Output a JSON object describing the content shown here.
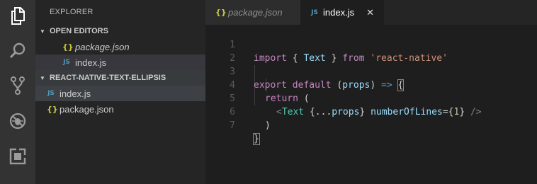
{
  "activity_bar": {
    "icons": [
      "files-icon",
      "search-icon",
      "source-control-icon",
      "debug-icon",
      "extensions-icon"
    ]
  },
  "sidebar": {
    "title": "EXPLORER",
    "open_editors": {
      "header": "OPEN EDITORS",
      "items": [
        {
          "icon": "{}",
          "label": "package.json"
        },
        {
          "icon": "JS",
          "label": "index.js"
        }
      ]
    },
    "project": {
      "header": "REACT-NATIVE-TEXT-ELLIPSIS",
      "items": [
        {
          "icon": "JS",
          "label": "index.js"
        },
        {
          "icon": "{}",
          "label": "package.json"
        }
      ]
    }
  },
  "tabs": [
    {
      "icon": "{}",
      "label": "package.json"
    },
    {
      "icon": "JS",
      "label": "index.js",
      "close": "✕"
    }
  ],
  "editor": {
    "line_numbers": [
      "1",
      "2",
      "3",
      "4",
      "5",
      "6",
      "7"
    ],
    "lines": {
      "l1": {
        "import": "import",
        "b1": " { ",
        "name": "Text",
        "b2": " } ",
        "from": "from",
        "sp": " ",
        "mod": "'react-native'"
      },
      "l3": {
        "export": "export",
        "sp1": " ",
        "default": "default",
        "sp2": " ",
        "paren1": "(",
        "props": "props",
        "paren2": ")",
        "arrow": " => ",
        "brace": "{"
      },
      "l4": {
        "return": "return",
        "rest": " ("
      },
      "l5": {
        "lt": "<",
        "tag": "Text",
        "attr1": " {...",
        "props": "props",
        "close1": "} ",
        "attr": "numberOfLines",
        "eq": "={",
        "num": "1",
        "close2": "} ",
        "end": "/>"
      },
      "l6": {
        "paren": ")"
      },
      "l7": {
        "brace": "}"
      }
    }
  }
}
